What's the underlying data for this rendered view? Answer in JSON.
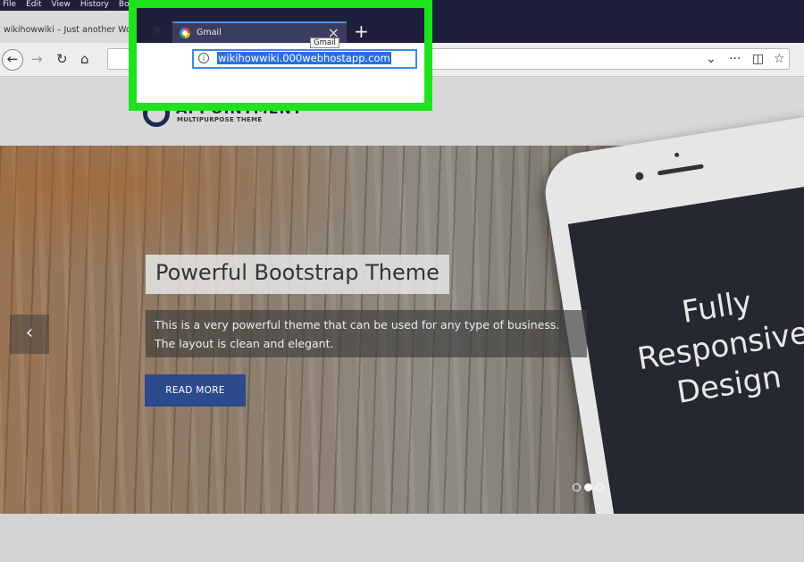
{
  "menubar": [
    "File",
    "Edit",
    "View",
    "History",
    "Bo"
  ],
  "tabs": [
    {
      "title": "wikihowwiki – Just another Wo"
    },
    {
      "title": "Gmail"
    }
  ],
  "tooltip": "Gmail",
  "addressbar": {
    "url": "wikihowwiki.000webhostapp.com"
  },
  "site": {
    "logo_name": "APPOINTMENT",
    "tagline": "MULTIPURPOSE THEME"
  },
  "hero": {
    "title": "Powerful Bootstrap Theme",
    "description": "This is a very powerful theme that can be used for any type of business. The layout is clean and elegant.",
    "button": "READ MORE",
    "phone_lines": [
      "Fully",
      "Responsive",
      "Design"
    ]
  },
  "icons": {
    "back": "back-arrow-icon",
    "forward": "forward-arrow-icon",
    "reload": "reload-icon",
    "home": "home-icon",
    "info": "info-icon"
  },
  "colors": {
    "highlight": "#1de31d",
    "button": "#2c4a8c",
    "tab_accent": "#4a90ff"
  }
}
